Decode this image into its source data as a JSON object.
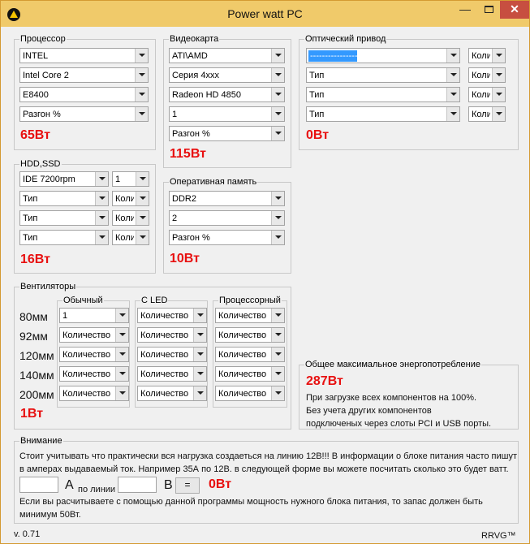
{
  "window": {
    "title": "Power watt PC",
    "minimize": "—",
    "maximize": "",
    "close": "✕"
  },
  "cpu": {
    "title": "Процессор",
    "brand": "INTEL",
    "series": "Intel Core 2",
    "model": "E8400",
    "overclock": "Разгон %",
    "watts": "65Вт"
  },
  "gpu": {
    "title": "Видеокарта",
    "brand": "ATI\\AMD",
    "series": "Серия 4xxx",
    "model": "Radeon HD 4850",
    "count": "1",
    "overclock": "Разгон %",
    "watts": "115Вт"
  },
  "optical": {
    "title": "Оптический привод",
    "rows": [
      {
        "type": "",
        "count": "Коли"
      },
      {
        "type": "Тип",
        "count": "Коли"
      },
      {
        "type": "Тип",
        "count": "Коли"
      },
      {
        "type": "Тип",
        "count": "Коли"
      }
    ],
    "watts": "0Вт"
  },
  "hdd": {
    "title": "HDD,SSD",
    "rows": [
      {
        "type": "IDE 7200rpm",
        "count": "1"
      },
      {
        "type": "Тип",
        "count": "Коли"
      },
      {
        "type": "Тип",
        "count": "Коли"
      },
      {
        "type": "Тип",
        "count": "Коли"
      }
    ],
    "watts": "16Вт"
  },
  "ram": {
    "title": "Оперативная память",
    "type": "DDR2",
    "count": "2",
    "overclock": "Разгон %",
    "watts": "10Вт"
  },
  "fans": {
    "title": "Вентиляторы",
    "columns": [
      "Обычный",
      "С LED",
      "Процессорный"
    ],
    "sizes": [
      "80мм",
      "92мм",
      "120мм",
      "140мм",
      "200мм"
    ],
    "rows": [
      [
        "1",
        "Количество",
        "Количество"
      ],
      [
        "Количество",
        "Количество",
        "Количество"
      ],
      [
        "Количество",
        "Количество",
        "Количество"
      ],
      [
        "Количество",
        "Количество",
        "Количество"
      ],
      [
        "Количество",
        "Количество",
        "Количество"
      ]
    ],
    "watts": "1Вт"
  },
  "total": {
    "title": "Общее максимальное энергопотребление",
    "watts": "287Вт",
    "line1": "При загрузке всех компонентов на 100%.",
    "line2": "Без учета других компонентов",
    "line3": "подключеных через слоты PCI и USB порты."
  },
  "attention": {
    "title": "Внимание",
    "text1": "Стоит учитывать что практически вся нагрузка создаеться на линию 12В!!! В информации о блоке питания часто пишут",
    "text2": "в амперах выдаваемый ток. Например 35А по 12В.  в следующей форме вы можете посчитать сколько это будет ватт.",
    "amp_label": "A",
    "line_label": "по линии",
    "volt_label": "B",
    "eq_button": "=",
    "result": "0Вт",
    "text3": "Если вы расчитываете с помощью данной программы мощность нужного блока питания, то запас должен быть",
    "text4": "минимум 50Вт."
  },
  "footer": {
    "version": "v. 0.71",
    "brand": "RRVG™"
  }
}
